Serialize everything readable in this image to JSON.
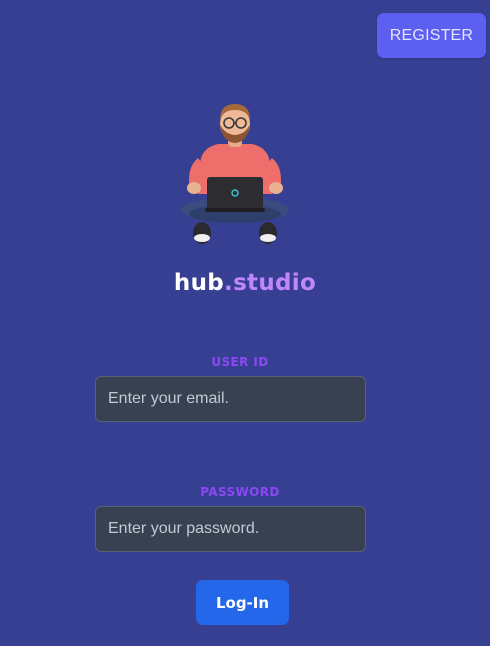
{
  "header": {
    "register_label": "REGISTER"
  },
  "hero": {
    "illustration": "person-with-laptop-avatar",
    "brand_part1": "hub",
    "brand_part2": ".studio"
  },
  "form": {
    "user_id_label": "USER ID",
    "email_placeholder": "Enter your email.",
    "email_value": "",
    "password_label": "PASSWORD",
    "password_placeholder": "Enter your password.",
    "password_value": "",
    "login_label": "Log-In"
  },
  "colors": {
    "background": "#363f92",
    "register_button": "#5d5ff0",
    "brand_accent": "#bf87fb",
    "field_label": "#8d47f5",
    "input_background": "#374151",
    "login_button": "#2567ea"
  }
}
